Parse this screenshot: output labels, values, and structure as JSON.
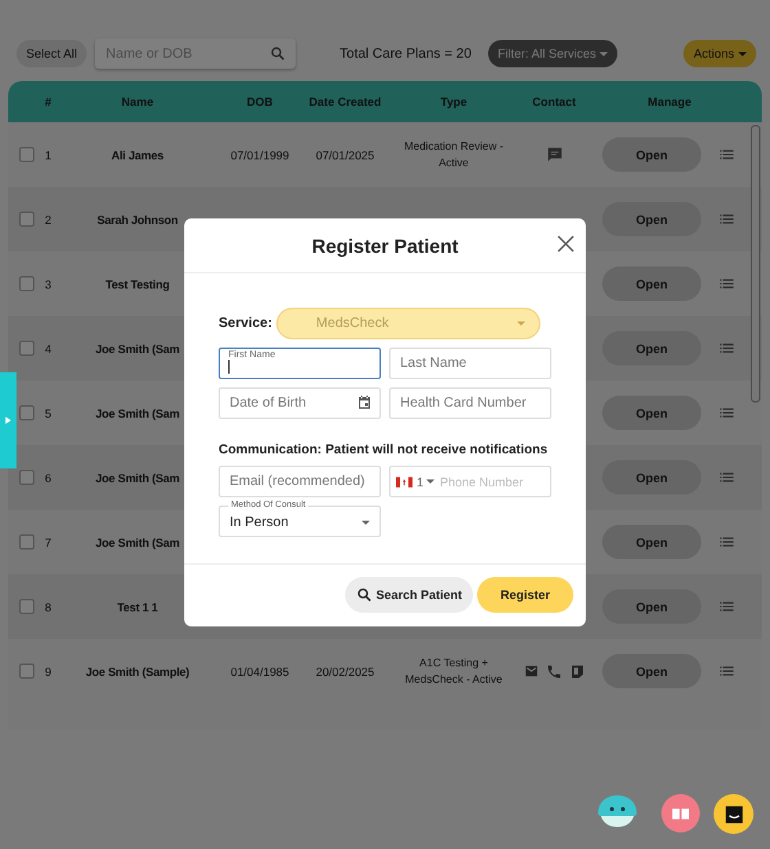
{
  "toolbar": {
    "select_all": "Select All",
    "search": {
      "placeholder": "Name or DOB"
    },
    "total": "Total Care Plans = 20",
    "filter": "Filter: All Services",
    "actions": "Actions"
  },
  "table": {
    "columns": [
      "#",
      "Name",
      "DOB",
      "Date Created",
      "Type",
      "Contact",
      "Manage"
    ],
    "rows": [
      {
        "checked": false,
        "number": "1",
        "name": "Ali James",
        "dob": "07/01/1999",
        "created": "07/01/2025",
        "type": "Medication Review - Active",
        "contact": [
          {
            "kind": "chat"
          }
        ],
        "manage": "Open"
      },
      {
        "checked": false,
        "number": "2",
        "name": "Sarah Johnson",
        "manage": "Open"
      },
      {
        "checked": false,
        "number": "3",
        "name": "Test Testing",
        "manage": "Open"
      },
      {
        "checked": false,
        "number": "4",
        "name": "Joe Smith (Sam",
        "manage": "Open"
      },
      {
        "checked": false,
        "number": "5",
        "name": "Joe Smith (Sam",
        "manage": "Open"
      },
      {
        "checked": false,
        "number": "6",
        "name": "Joe Smith (Sam",
        "manage": "Open"
      },
      {
        "checked": false,
        "number": "7",
        "name": "Joe Smith (Sam",
        "manage": "Open"
      },
      {
        "checked": false,
        "number": "8",
        "name": "Test 1 1",
        "manage": "Open"
      },
      {
        "checked": false,
        "number": "9",
        "name": "Joe Smith (Sample)",
        "dob": "01/04/1985",
        "created": "20/02/2025",
        "type": "A1C Testing + MedsCheck - Active",
        "contact": [
          {
            "kind": "email"
          },
          {
            "kind": "phone"
          },
          {
            "kind": "note"
          }
        ],
        "manage": "Open"
      }
    ]
  },
  "dialog": {
    "title": "Register Patient",
    "service": {
      "label": "Service:",
      "value": "MedsCheck"
    },
    "fields": [
      {
        "kind": "text",
        "label": "First Name",
        "focused": true
      },
      {
        "kind": "text",
        "placeholder": "Last Name",
        "focused": false
      },
      {
        "kind": "date",
        "placeholder": "Date of Birth",
        "focused": false
      },
      {
        "kind": "text",
        "placeholder": "Health Card Number",
        "focused": false
      }
    ],
    "communication": "Communication: Patient will not receive notifications",
    "contact_fields": [
      {
        "kind": "text",
        "placeholder": "Email (recommended)",
        "focused": false
      },
      {
        "kind": "phone",
        "country_code": "1",
        "placeholder": "Phone Number",
        "focused": false
      }
    ],
    "consult": {
      "label": "Method Of Consult",
      "value": "In Person"
    },
    "buttons": [
      {
        "kind": "search",
        "label": "Search Patient"
      },
      {
        "kind": "primary",
        "label": "Register"
      }
    ]
  }
}
